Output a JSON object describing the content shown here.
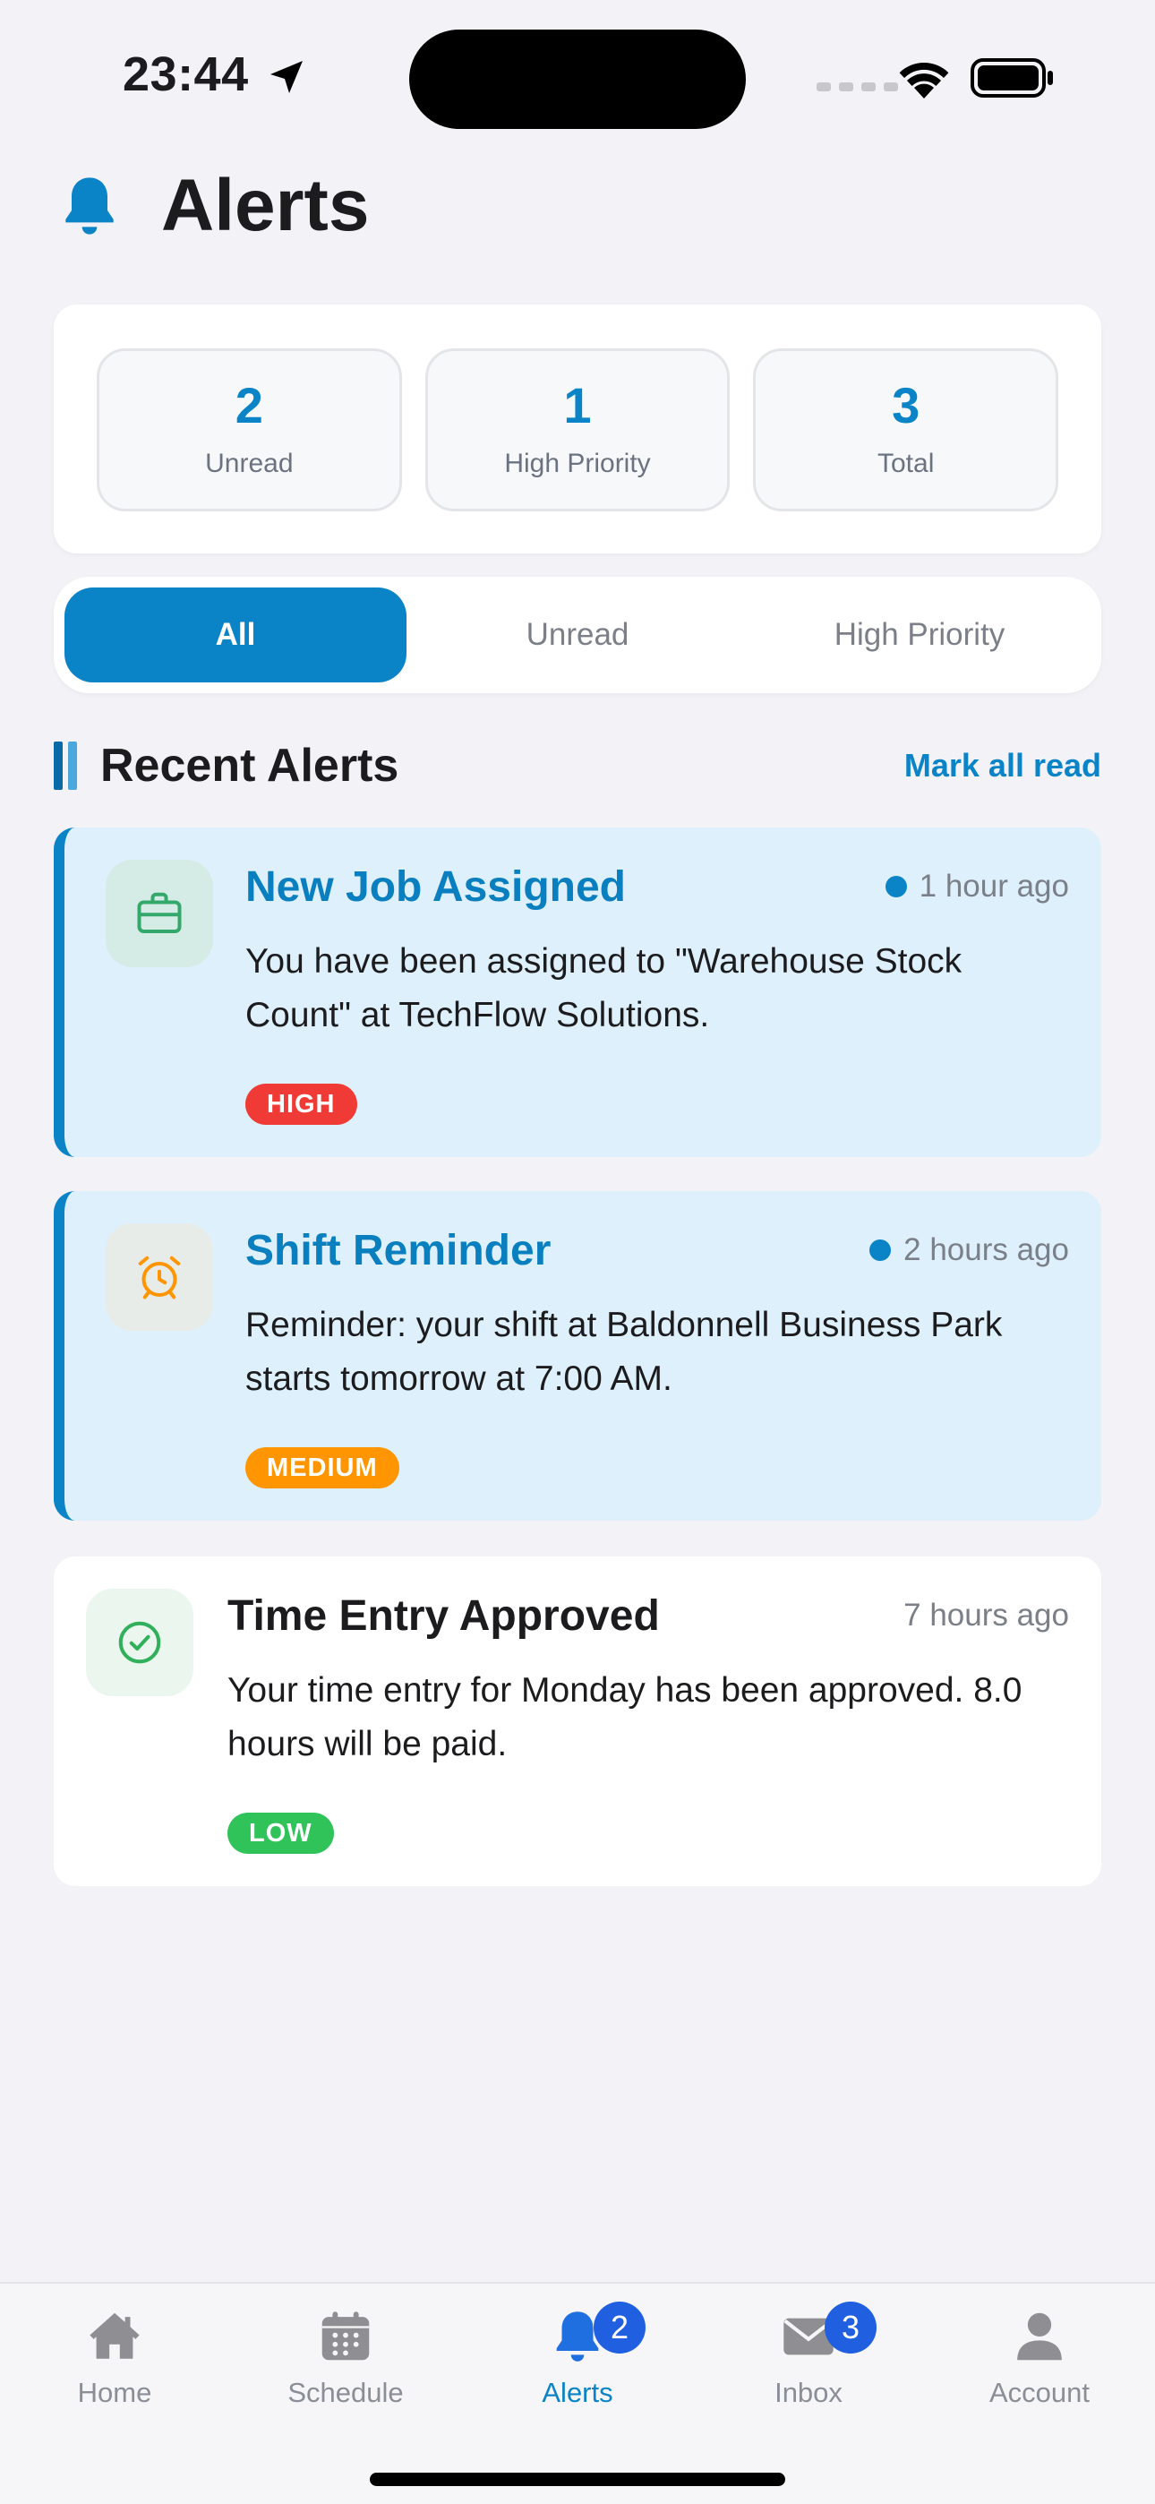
{
  "status_bar": {
    "time": "23:44"
  },
  "header": {
    "title": "Alerts"
  },
  "stats": [
    {
      "value": "2",
      "label": "Unread"
    },
    {
      "value": "1",
      "label": "High Priority"
    },
    {
      "value": "3",
      "label": "Total"
    }
  ],
  "filters": [
    {
      "label": "All",
      "active": true
    },
    {
      "label": "Unread",
      "active": false
    },
    {
      "label": "High Priority",
      "active": false
    }
  ],
  "section": {
    "title": "Recent Alerts",
    "action": "Mark all read"
  },
  "alerts": [
    {
      "title": "New Job Assigned",
      "time": "1 hour ago",
      "message": "You have been assigned to \"Warehouse Stock Count\" at TechFlow Solutions.",
      "priority": "HIGH",
      "icon": "briefcase-icon",
      "unread": true
    },
    {
      "title": "Shift Reminder",
      "time": "2 hours ago",
      "message": "Reminder: your shift at Baldonnell Business Park starts tomorrow at 7:00 AM.",
      "priority": "MEDIUM",
      "icon": "alarm-clock-icon",
      "unread": true
    },
    {
      "title": "Time Entry Approved",
      "time": "7 hours ago",
      "message": "Your time entry for Monday has been approved. 8.0 hours will be paid.",
      "priority": "LOW",
      "icon": "check-circle-icon",
      "unread": false
    }
  ],
  "colors": {
    "accent": "#0a84c6",
    "high": "#f03a35",
    "medium": "#ff9500",
    "low": "#30c35a"
  },
  "tabbar": {
    "items": [
      {
        "label": "Home",
        "icon": "house-icon"
      },
      {
        "label": "Schedule",
        "icon": "calendar-icon"
      },
      {
        "label": "Alerts",
        "icon": "bell-icon",
        "badge": "2",
        "active": true
      },
      {
        "label": "Inbox",
        "icon": "envelope-icon",
        "badge": "3"
      },
      {
        "label": "Account",
        "icon": "person-icon"
      }
    ]
  }
}
